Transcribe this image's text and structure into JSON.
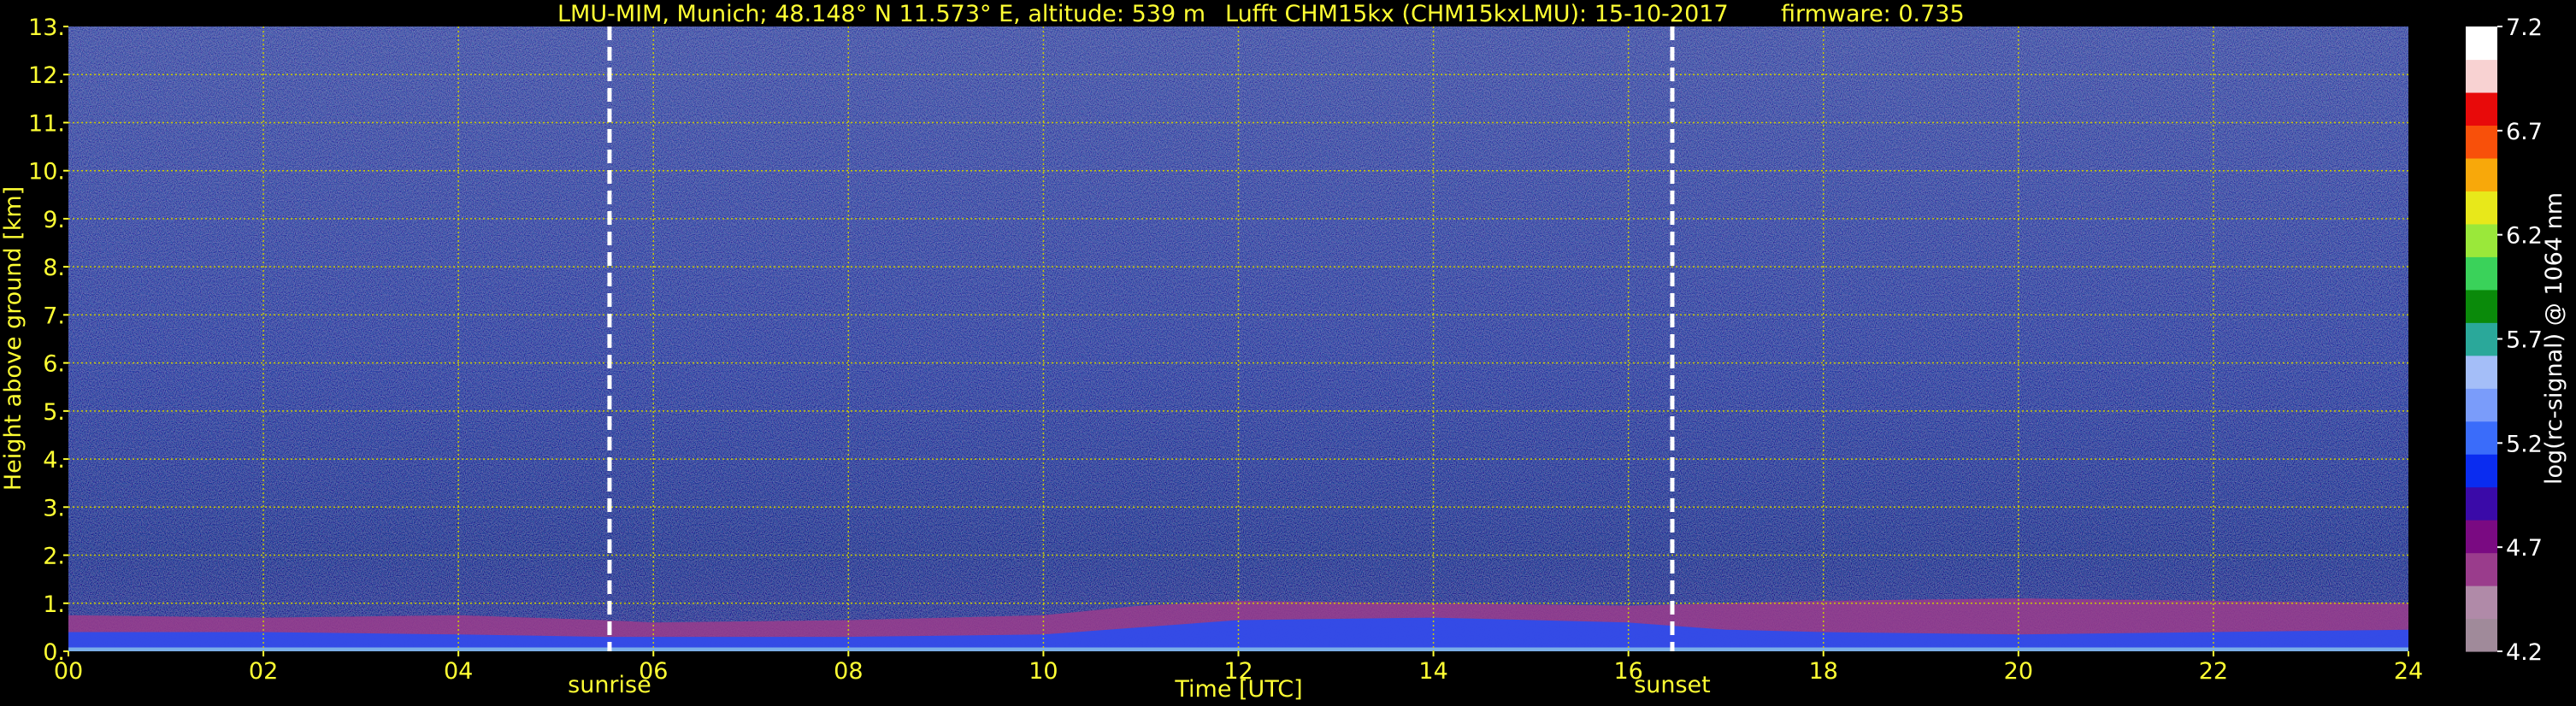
{
  "chart_data": {
    "type": "heatmap",
    "title_parts": {
      "station": "LMU-MIM, Munich; 48.148° N 11.573° E, altitude: 539 m",
      "instrument": "Lufft CHM15kx (CHM15kxLMU): 15-10-2017",
      "firmware": "firmware: 0.735"
    },
    "xlabel": "Time [UTC]",
    "ylabel": "Height above ground [km]",
    "xlim": [
      0,
      24
    ],
    "ylim": [
      0,
      13
    ],
    "x_ticks": [
      "00",
      "02",
      "04",
      "06",
      "08",
      "10",
      "12",
      "14",
      "16",
      "18",
      "20",
      "22",
      "24"
    ],
    "y_ticks": [
      "0.",
      "1.",
      "2.",
      "3.",
      "4.",
      "5.",
      "6.",
      "7.",
      "8.",
      "9.",
      "10.",
      "11.",
      "12.",
      "13."
    ],
    "grid": true,
    "events": [
      {
        "label": "sunrise",
        "time": 5.55
      },
      {
        "label": "sunset",
        "time": 16.45
      }
    ],
    "colorbar": {
      "label": "log(rc-signal) @ 1064 nm",
      "range": [
        4.2,
        7.2
      ],
      "ticks": [
        "4.2",
        "4.7",
        "5.2",
        "5.7",
        "6.2",
        "6.7",
        "7.2"
      ]
    },
    "boundary_layer_top_km": [
      [
        0,
        0.75
      ],
      [
        2,
        0.7
      ],
      [
        4,
        0.75
      ],
      [
        5.5,
        0.65
      ],
      [
        6,
        0.6
      ],
      [
        8,
        0.65
      ],
      [
        10,
        0.75
      ],
      [
        11,
        0.95
      ],
      [
        12,
        1.05
      ],
      [
        14,
        1.0
      ],
      [
        16,
        0.95
      ],
      [
        17,
        1.0
      ],
      [
        18,
        1.05
      ],
      [
        20,
        1.1
      ],
      [
        22,
        1.05
      ],
      [
        24,
        1.0
      ]
    ],
    "aerosol_layer_top_km": [
      [
        0,
        0.4
      ],
      [
        2,
        0.4
      ],
      [
        4,
        0.35
      ],
      [
        5.5,
        0.3
      ],
      [
        8,
        0.3
      ],
      [
        10,
        0.35
      ],
      [
        11,
        0.5
      ],
      [
        12,
        0.65
      ],
      [
        14,
        0.7
      ],
      [
        16,
        0.6
      ],
      [
        17,
        0.45
      ],
      [
        18,
        0.4
      ],
      [
        20,
        0.35
      ],
      [
        22,
        0.4
      ],
      [
        24,
        0.45
      ]
    ]
  },
  "colors": {
    "background": "#000000",
    "text": "#ffff33",
    "grid": "#cccc00",
    "colorbar_stops": [
      "#a08a9a",
      "#b08aa8",
      "#9a3c8c",
      "#7a0a82",
      "#3a0aa8",
      "#0a2cf0",
      "#3a6cfa",
      "#7a9cfa",
      "#a4bef8",
      "#2aa89a",
      "#0a8a0a",
      "#3ad25a",
      "#9ae83a",
      "#e8e81a",
      "#f8a80a",
      "#f8500a",
      "#e80a0a",
      "#f8d2d2",
      "#ffffff"
    ]
  }
}
